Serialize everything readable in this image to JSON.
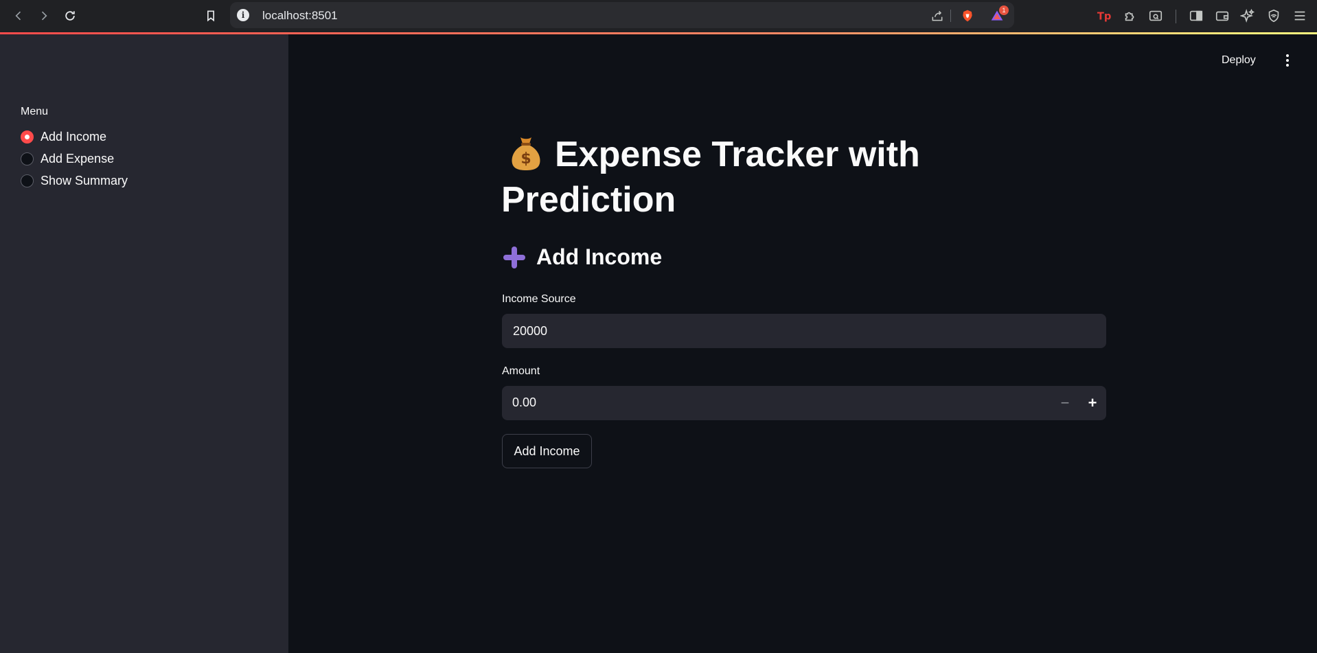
{
  "browser": {
    "url": "localhost:8501",
    "notification_count": "1"
  },
  "sidebar": {
    "menu_label": "Menu",
    "options": [
      {
        "label": "Add Income",
        "selected": true
      },
      {
        "label": "Add Expense",
        "selected": false
      },
      {
        "label": "Show Summary",
        "selected": false
      }
    ]
  },
  "header": {
    "deploy_label": "Deploy"
  },
  "main": {
    "title": "Expense Tracker with Prediction",
    "title_icon": "money-bag-icon",
    "subheader": "Add Income",
    "subheader_icon": "plus-icon",
    "income_source": {
      "label": "Income Source",
      "value": "20000"
    },
    "amount": {
      "label": "Amount",
      "value": "0.00",
      "decrement": "−",
      "increment": "+"
    },
    "submit_label": "Add Income"
  },
  "colors": {
    "accent": "#ff4b4b",
    "background": "#0e1117",
    "sidebar": "#262730",
    "input_bg": "#262730"
  }
}
